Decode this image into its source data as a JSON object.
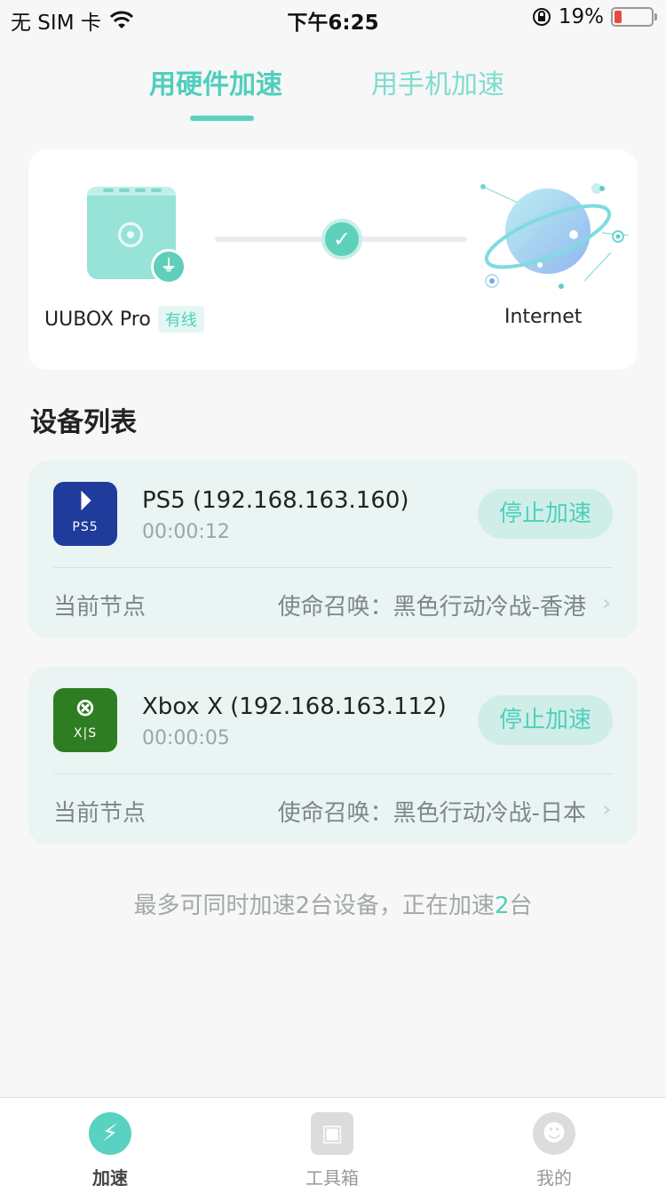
{
  "status_bar": {
    "carrier": "无 SIM 卡",
    "time": "下午6:25",
    "battery": "19%",
    "battery_level": 0.19
  },
  "tabs": [
    {
      "label": "用硬件加速",
      "active": true
    },
    {
      "label": "用手机加速",
      "active": false
    }
  ],
  "connection": {
    "device_name": "UUBOX Pro",
    "connection_type": "有线",
    "destination": "Internet",
    "status": "connected"
  },
  "device_list": {
    "title": "设备列表",
    "devices": [
      {
        "name": "PS5 (192.168.163.160)",
        "elapsed": "00:00:12",
        "icon": "ps5-icon",
        "icon_text": "PS5",
        "icon_color": "#1f3b9b",
        "action": "停止加速",
        "node_label": "当前节点",
        "node_value": "使命召唤：黑色行动冷战-香港"
      },
      {
        "name": "Xbox X (192.168.163.112)",
        "elapsed": "00:00:05",
        "icon": "xbox-icon",
        "icon_text": "X|S",
        "icon_color": "#2f7d22",
        "action": "停止加速",
        "node_label": "当前节点",
        "node_value": "使命召唤：黑色行动冷战-日本"
      }
    ]
  },
  "footer_note": {
    "prefix": "最多可同时加速2台设备，正在加速",
    "count": "2",
    "suffix": "台"
  },
  "bottom_nav": [
    {
      "label": "加速",
      "icon": "lightning-icon",
      "active": true
    },
    {
      "label": "工具箱",
      "icon": "toolbox-icon",
      "active": false
    },
    {
      "label": "我的",
      "icon": "profile-icon",
      "active": false
    }
  ],
  "colors": {
    "accent": "#4fcfbc",
    "card_bg": "#eaf4f3",
    "page_bg": "#f7f7f7"
  }
}
